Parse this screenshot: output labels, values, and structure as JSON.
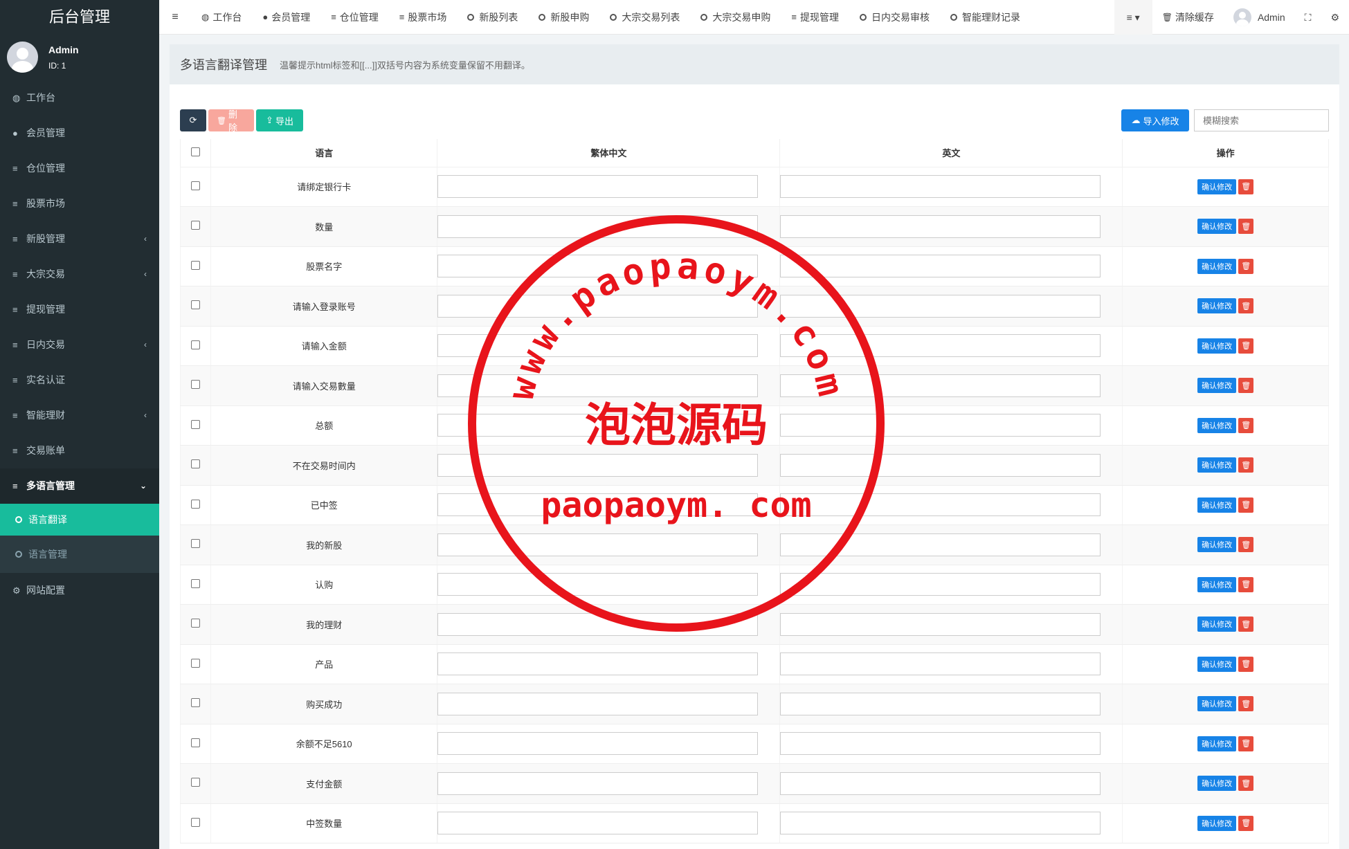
{
  "sidebar": {
    "logo": "后台管理",
    "user": {
      "name": "Admin",
      "id": "ID: 1"
    },
    "menu": [
      {
        "label": "工作台",
        "icon": "dashboard-icon",
        "glyph": "◍"
      },
      {
        "label": "会员管理",
        "icon": "user-circle-icon",
        "glyph": "●"
      },
      {
        "label": "仓位管理",
        "icon": "list-icon",
        "glyph": "≡"
      },
      {
        "label": "股票市场",
        "icon": "list-icon",
        "glyph": "≡"
      },
      {
        "label": "新股管理",
        "icon": "list-icon",
        "glyph": "≡",
        "arrow": "‹"
      },
      {
        "label": "大宗交易",
        "icon": "list-icon",
        "glyph": "≡",
        "arrow": "‹"
      },
      {
        "label": "提现管理",
        "icon": "list-icon",
        "glyph": "≡"
      },
      {
        "label": "日内交易",
        "icon": "list-icon",
        "glyph": "≡",
        "arrow": "‹"
      },
      {
        "label": "实名认证",
        "icon": "list-icon",
        "glyph": "≡"
      },
      {
        "label": "智能理财",
        "icon": "list-icon",
        "glyph": "≡",
        "arrow": "‹"
      },
      {
        "label": "交易账单",
        "icon": "list-icon",
        "glyph": "≡"
      }
    ],
    "open_menu": {
      "label": "多语言管理",
      "icon": "list-icon",
      "glyph": "≡",
      "arrow": "⌄"
    },
    "sub_menu": [
      {
        "label": "语言翻译",
        "active": true
      },
      {
        "label": "语言管理",
        "active": false
      }
    ],
    "last_menu": {
      "label": "网站配置",
      "icon": "gear-icon",
      "glyph": "⚙"
    }
  },
  "topnav": {
    "tabs": [
      {
        "label": "工作台",
        "icon": "dashboard-icon",
        "glyph": "◍"
      },
      {
        "label": "会员管理",
        "icon": "user-circle-icon",
        "glyph": "●"
      },
      {
        "label": "仓位管理",
        "icon": "list-icon",
        "glyph": "≡"
      },
      {
        "label": "股票市场",
        "icon": "list-icon",
        "glyph": "≡"
      },
      {
        "label": "新股列表",
        "icon": "circle-icon"
      },
      {
        "label": "新股申购",
        "icon": "circle-icon"
      },
      {
        "label": "大宗交易列表",
        "icon": "circle-icon"
      },
      {
        "label": "大宗交易申购",
        "icon": "circle-icon"
      },
      {
        "label": "提现管理",
        "icon": "list-icon",
        "glyph": "≡"
      },
      {
        "label": "日内交易审核",
        "icon": "circle-icon"
      },
      {
        "label": "智能理财记录",
        "icon": "circle-icon"
      }
    ],
    "clear_cache": "清除缓存",
    "admin_name": "Admin"
  },
  "page": {
    "title": "多语言翻译管理",
    "tip": "温馨提示html标签和[[...]]双括号内容为系统变量保留不用翻译。"
  },
  "toolbar": {
    "delete_label": "删除",
    "export_label": "导出",
    "import_label": "导入修改",
    "search_placeholder": "模糊搜索"
  },
  "table": {
    "headers": [
      "语言",
      "繁体中文",
      "英文",
      "操作"
    ],
    "confirm_label": "确认修改",
    "rows": [
      "请绑定银行卡",
      "数量",
      "股票名字",
      "请输入登录账号",
      "请输入金额",
      "请输入交易數量",
      "总额",
      "不在交易时间内",
      "已中签",
      "我的新股",
      "认购",
      "我的理财",
      "产品",
      "购买成功",
      "余额不足5610",
      "支付金额",
      "中签数量"
    ]
  },
  "watermark": {
    "arc_text": "www.paopaoym.com",
    "center_text": "泡泡源码",
    "bottom_text": "paopaoym. com",
    "color": "#e8141b"
  },
  "colors": {
    "sidebar_bg": "#222d32",
    "active": "#18bc9c",
    "primary": "#1783e7",
    "danger": "#e74c3c"
  }
}
